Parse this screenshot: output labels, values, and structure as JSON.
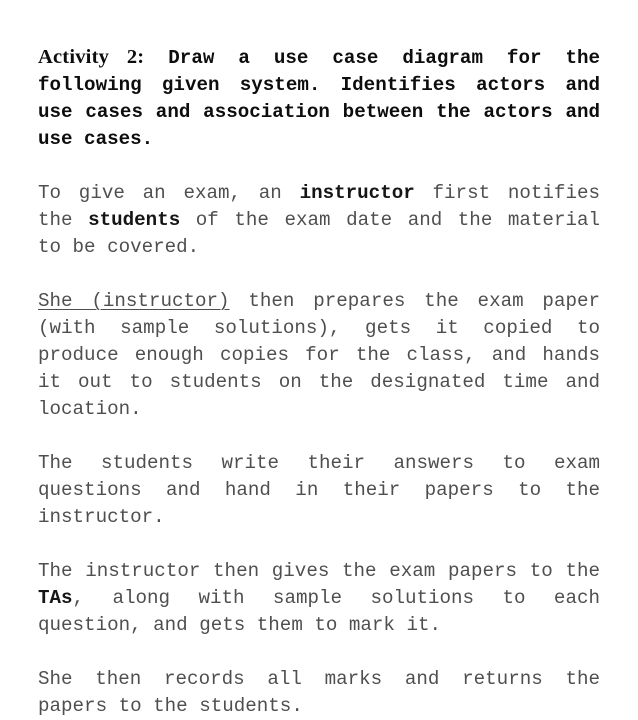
{
  "document": {
    "background_color": "#ffffff",
    "body_text_color": "#4f4f4f",
    "emphasis_text_color": "#151515",
    "heading": {
      "label": "Activity 2:",
      "rest": "Draw a use case diagram for the following given system. Identifies actors and use cases and association between the actors and use cases."
    },
    "paragraphs": [
      {
        "id": "p1",
        "segments": [
          {
            "text": "To give an exam, an ",
            "style": "normal"
          },
          {
            "text": "instructor",
            "style": "bold"
          },
          {
            "text": " first notifies the ",
            "style": "normal"
          },
          {
            "text": "students",
            "style": "bold"
          },
          {
            "text": " of the exam date and the material to be covered.",
            "style": "normal"
          }
        ]
      },
      {
        "id": "p2",
        "segments": [
          {
            "text": "She (instructor)",
            "style": "underline"
          },
          {
            "text": " then prepares the exam paper (with sample solutions), gets it copied to produce enough copies for the class, and hands it out to students on the designated time and location.",
            "style": "normal"
          }
        ]
      },
      {
        "id": "p3",
        "segments": [
          {
            "text": "The students write their answers to exam questions and hand in their papers to the instructor.",
            "style": "normal"
          }
        ]
      },
      {
        "id": "p4",
        "segments": [
          {
            "text": "The instructor then gives the exam papers to the ",
            "style": "normal"
          },
          {
            "text": "TAs",
            "style": "bold"
          },
          {
            "text": ", along with sample solutions to each question, and gets them to mark it.",
            "style": "normal"
          }
        ]
      },
      {
        "id": "p5",
        "segments": [
          {
            "text": "She then records all marks and returns the papers to the students.",
            "style": "normal"
          }
        ]
      }
    ]
  }
}
